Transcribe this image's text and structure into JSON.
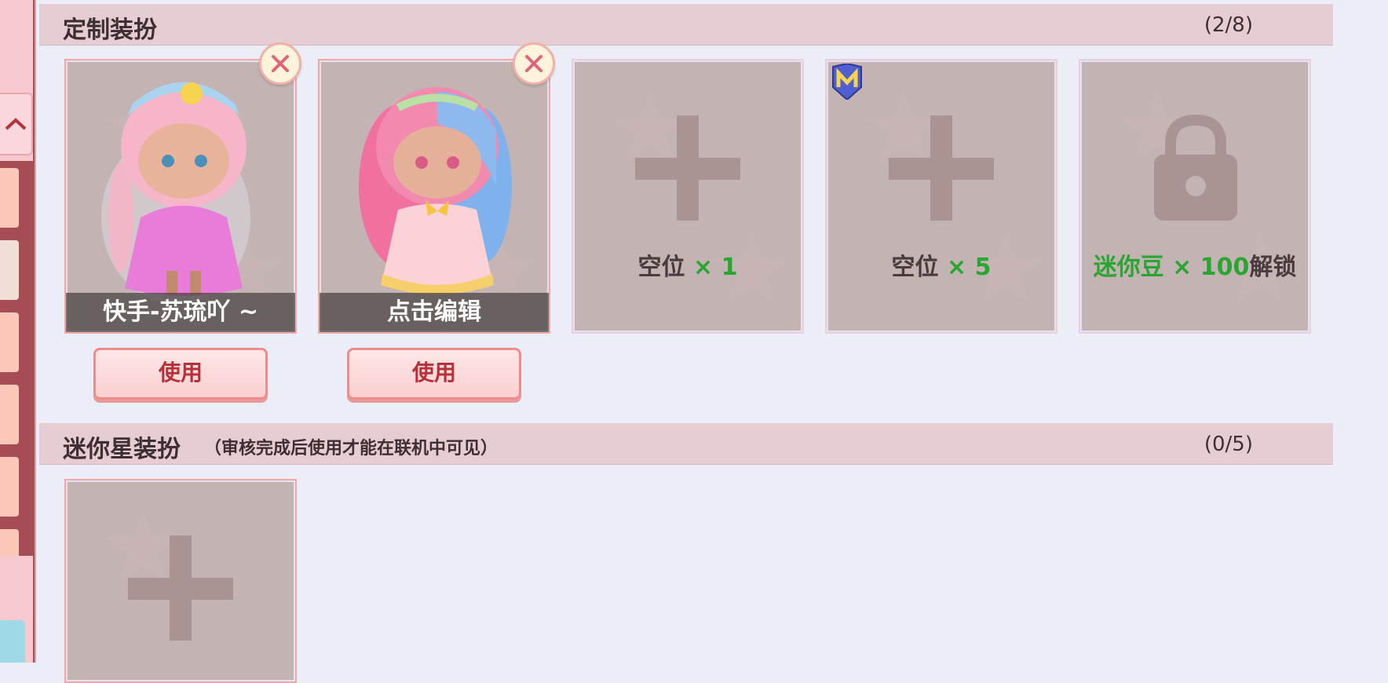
{
  "custom_section": {
    "title": "定制装扮",
    "count": "(2/8)",
    "slots": [
      {
        "name": "快手-苏琉吖 ~",
        "use_label": "使用"
      },
      {
        "name": "点击编辑",
        "use_label": "使用"
      },
      {
        "label_prefix": "空位",
        "label_value": "× 1"
      },
      {
        "label_prefix": "空位",
        "label_value": "× 5",
        "badge_icon": "m-badge-icon"
      },
      {
        "label_prefix_green": "迷你豆 × 100",
        "label_suffix": "解锁"
      }
    ]
  },
  "mini_star_section": {
    "title": "迷你星装扮",
    "subtitle": "（审核完成后使用才能在联机中可见）",
    "count": "(0/5)"
  },
  "colors": {
    "header_bg": "#e6cdd3",
    "slot_bg": "#c3b3b3",
    "accent_green": "#2aa531",
    "button_text": "#b6303a"
  }
}
